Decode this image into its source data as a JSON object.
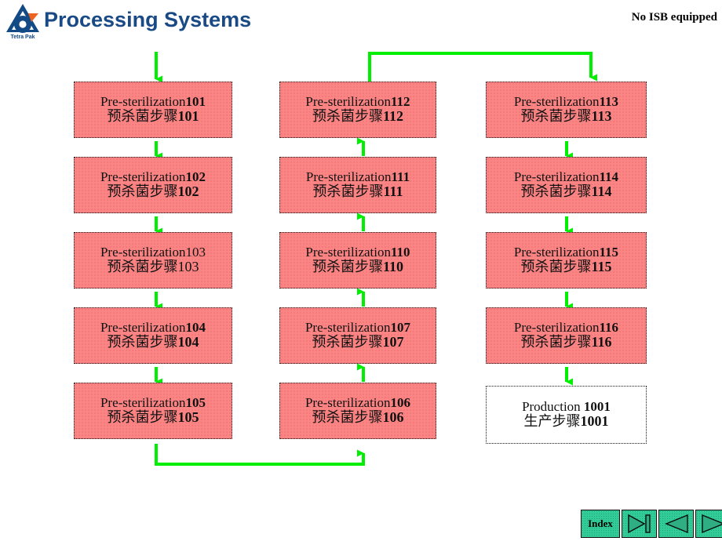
{
  "header": {
    "title": "Processing Systems",
    "note": "No ISB equipped",
    "logo_icon": "tetra-pak-logo-icon",
    "title_color": "#1a4a86"
  },
  "colors": {
    "box_fill": "#fb8585",
    "box_border": "#1a1a1a",
    "arrow": "#00ee00",
    "nav_fill": "#33cc99",
    "production_fill": "#ffffff"
  },
  "diagram": {
    "type": "flowchart",
    "columns": [
      {
        "name": "column-1",
        "flow_direction": "down",
        "boxes": [
          {
            "id": "box-101",
            "en_label": "Pre-sterilization",
            "en_num": "101",
            "cn_label": "预杀菌步骤",
            "cn_num": "101",
            "kind": "sterilization",
            "bold_num": true
          },
          {
            "id": "box-102",
            "en_label": "Pre-sterilization",
            "en_num": "102",
            "cn_label": "预杀菌步骤",
            "cn_num": "102",
            "kind": "sterilization",
            "bold_num": true
          },
          {
            "id": "box-103",
            "en_label": "Pre-sterilization",
            "en_num": "103",
            "cn_label": "预杀菌步骤",
            "cn_num": "103",
            "kind": "sterilization",
            "bold_num": false
          },
          {
            "id": "box-104",
            "en_label": "Pre-sterilization",
            "en_num": "104",
            "cn_label": "预杀菌步骤",
            "cn_num": "104",
            "kind": "sterilization",
            "bold_num": true
          },
          {
            "id": "box-105",
            "en_label": "Pre-sterilization",
            "en_num": "105",
            "cn_label": "预杀菌步骤",
            "cn_num": "105",
            "kind": "sterilization",
            "bold_num": true
          }
        ]
      },
      {
        "name": "column-2",
        "flow_direction": "up",
        "boxes": [
          {
            "id": "box-112",
            "en_label": "Pre-sterilization",
            "en_num": "112",
            "cn_label": "预杀菌步骤",
            "cn_num": "112",
            "kind": "sterilization",
            "bold_num": true
          },
          {
            "id": "box-111",
            "en_label": "Pre-sterilization",
            "en_num": "111",
            "cn_label": "预杀菌步骤",
            "cn_num": "111",
            "kind": "sterilization",
            "bold_num": true
          },
          {
            "id": "box-110",
            "en_label": "Pre-sterilization",
            "en_num": "110",
            "cn_label": "预杀菌步骤",
            "cn_num": "110",
            "kind": "sterilization",
            "bold_num": true
          },
          {
            "id": "box-107",
            "en_label": "Pre-sterilization",
            "en_num": "107",
            "cn_label": "预杀菌步骤",
            "cn_num": "107",
            "kind": "sterilization",
            "bold_num": true
          },
          {
            "id": "box-106",
            "en_label": "Pre-sterilization",
            "en_num": "106",
            "cn_label": "预杀菌步骤",
            "cn_num": "106",
            "kind": "sterilization",
            "bold_num": true
          }
        ]
      },
      {
        "name": "column-3",
        "flow_direction": "down",
        "boxes": [
          {
            "id": "box-113",
            "en_label": "Pre-sterilization",
            "en_num": "113",
            "cn_label": "预杀菌步骤",
            "cn_num": "113",
            "kind": "sterilization",
            "bold_num": true
          },
          {
            "id": "box-114",
            "en_label": "Pre-sterilization",
            "en_num": "114",
            "cn_label": "预杀菌步骤",
            "cn_num": "114",
            "kind": "sterilization",
            "bold_num": true
          },
          {
            "id": "box-115",
            "en_label": "Pre-sterilization",
            "en_num": "115",
            "cn_label": "预杀菌步骤",
            "cn_num": "115",
            "kind": "sterilization",
            "bold_num": true
          },
          {
            "id": "box-116",
            "en_label": "Pre-sterilization",
            "en_num": "116",
            "cn_label": "预杀菌步骤",
            "cn_num": "116",
            "kind": "sterilization",
            "bold_num": true
          },
          {
            "id": "box-1001",
            "en_label": "Production ",
            "en_num": "1001",
            "cn_label": "生产步骤",
            "cn_num": "1001",
            "kind": "production",
            "bold_num": true
          }
        ]
      }
    ]
  },
  "nav": {
    "index_label": "Index",
    "buttons": [
      {
        "name": "index-button",
        "label": "Index",
        "icon": "text-label"
      },
      {
        "name": "last-slide-button",
        "label": "",
        "icon": "skip-forward-icon"
      },
      {
        "name": "previous-slide-button",
        "label": "",
        "icon": "triangle-left-icon"
      },
      {
        "name": "next-slide-button",
        "label": "",
        "icon": "triangle-right-icon"
      }
    ]
  }
}
